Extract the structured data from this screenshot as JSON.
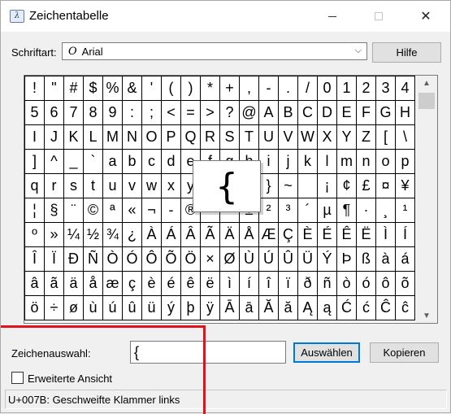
{
  "window": {
    "title": "Zeichentabelle",
    "app_icon_glyph": "λ"
  },
  "controls": {
    "font_label": "Schriftart:",
    "font_selected": "Arial",
    "font_icon_glyph": "O",
    "help_button": "Hilfe",
    "char_selection_label": "Zeichenauswahl:",
    "char_selection_value": "{",
    "select_button": "Auswählen",
    "copy_button": "Kopieren",
    "advanced_view_label": "Erweiterte Ansicht",
    "advanced_view_checked": false
  },
  "magnified_char": "{",
  "status": "U+007B: Geschweifte Klammer links",
  "grid": [
    [
      "!",
      "\"",
      "#",
      "$",
      "%",
      "&",
      "'",
      "(",
      ")",
      "*",
      "+",
      ",",
      "-",
      ".",
      "/",
      "0",
      "1",
      "2",
      "3",
      "4"
    ],
    [
      "5",
      "6",
      "7",
      "8",
      "9",
      ":",
      ";",
      "<",
      "=",
      ">",
      "?",
      "@",
      "A",
      "B",
      "C",
      "D",
      "E",
      "F",
      "G",
      "H"
    ],
    [
      "I",
      "J",
      "K",
      "L",
      "M",
      "N",
      "O",
      "P",
      "Q",
      "R",
      "S",
      "T",
      "U",
      "V",
      "W",
      "X",
      "Y",
      "Z",
      "[",
      "\\"
    ],
    [
      "]",
      "^",
      "_",
      "`",
      "a",
      "b",
      "c",
      "d",
      "e",
      "f",
      "g",
      "h",
      "i",
      "j",
      "k",
      "l",
      "m",
      "n",
      "o",
      "p"
    ],
    [
      "q",
      "r",
      "s",
      "t",
      "u",
      "v",
      "w",
      "x",
      "y",
      "z",
      "{",
      "|",
      "}",
      "~",
      " ",
      "¡",
      "¢",
      "£",
      "¤",
      "¥"
    ],
    [
      "¦",
      "§",
      "¨",
      "©",
      "ª",
      "«",
      "¬",
      "-",
      "®",
      "¯",
      "°",
      "±",
      "²",
      "³",
      "´",
      "µ",
      "¶",
      "·",
      "¸",
      "¹"
    ],
    [
      "º",
      "»",
      "¼",
      "½",
      "¾",
      "¿",
      "À",
      "Á",
      "Â",
      "Ã",
      "Ä",
      "Å",
      "Æ",
      "Ç",
      "È",
      "É",
      "Ê",
      "Ë",
      "Ì",
      "Í"
    ],
    [
      "Î",
      "Ï",
      "Ð",
      "Ñ",
      "Ò",
      "Ó",
      "Ô",
      "Õ",
      "Ö",
      "×",
      "Ø",
      "Ù",
      "Ú",
      "Û",
      "Ü",
      "Ý",
      "Þ",
      "ß",
      "à",
      "á"
    ],
    [
      "â",
      "ã",
      "ä",
      "å",
      "æ",
      "ç",
      "è",
      "é",
      "ê",
      "ë",
      "ì",
      "í",
      "î",
      "ï",
      "ð",
      "ñ",
      "ò",
      "ó",
      "ô",
      "õ"
    ],
    [
      "ö",
      "÷",
      "ø",
      "ù",
      "ú",
      "û",
      "ü",
      "ý",
      "þ",
      "ÿ",
      "Ā",
      "ā",
      "Ă",
      "ă",
      "Ą",
      "ą",
      "Ć",
      "ć",
      "Ĉ",
      "ĉ"
    ]
  ],
  "accent_colors": {
    "highlight_border": "#e0121b",
    "default_button_border": "#0078d7"
  }
}
